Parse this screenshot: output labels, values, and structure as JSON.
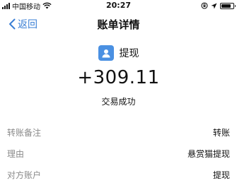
{
  "status_bar": {
    "carrier": "中国移动",
    "time": "20:27"
  },
  "nav": {
    "back_label": "返回",
    "title": "账单详情"
  },
  "transaction": {
    "party_name": "提现",
    "amount": "+309.11",
    "status": "交易成功"
  },
  "details": [
    {
      "label": "转账备注",
      "value": "转账"
    },
    {
      "label": "理由",
      "value": "悬赏猫提现"
    },
    {
      "label": "对方账户",
      "value": "提现"
    }
  ],
  "colors": {
    "accent": "#3a7fd5",
    "avatar": "#4a90e2",
    "label_gray": "#8a8a8a"
  },
  "icons": {
    "back": "chevron-left-icon",
    "avatar": "user-avatar-icon",
    "wifi": "wifi-icon",
    "lock_rotation": "rotation-lock-icon",
    "location": "location-arrow-icon",
    "battery": "battery-icon",
    "signal": "signal-bars-icon"
  }
}
